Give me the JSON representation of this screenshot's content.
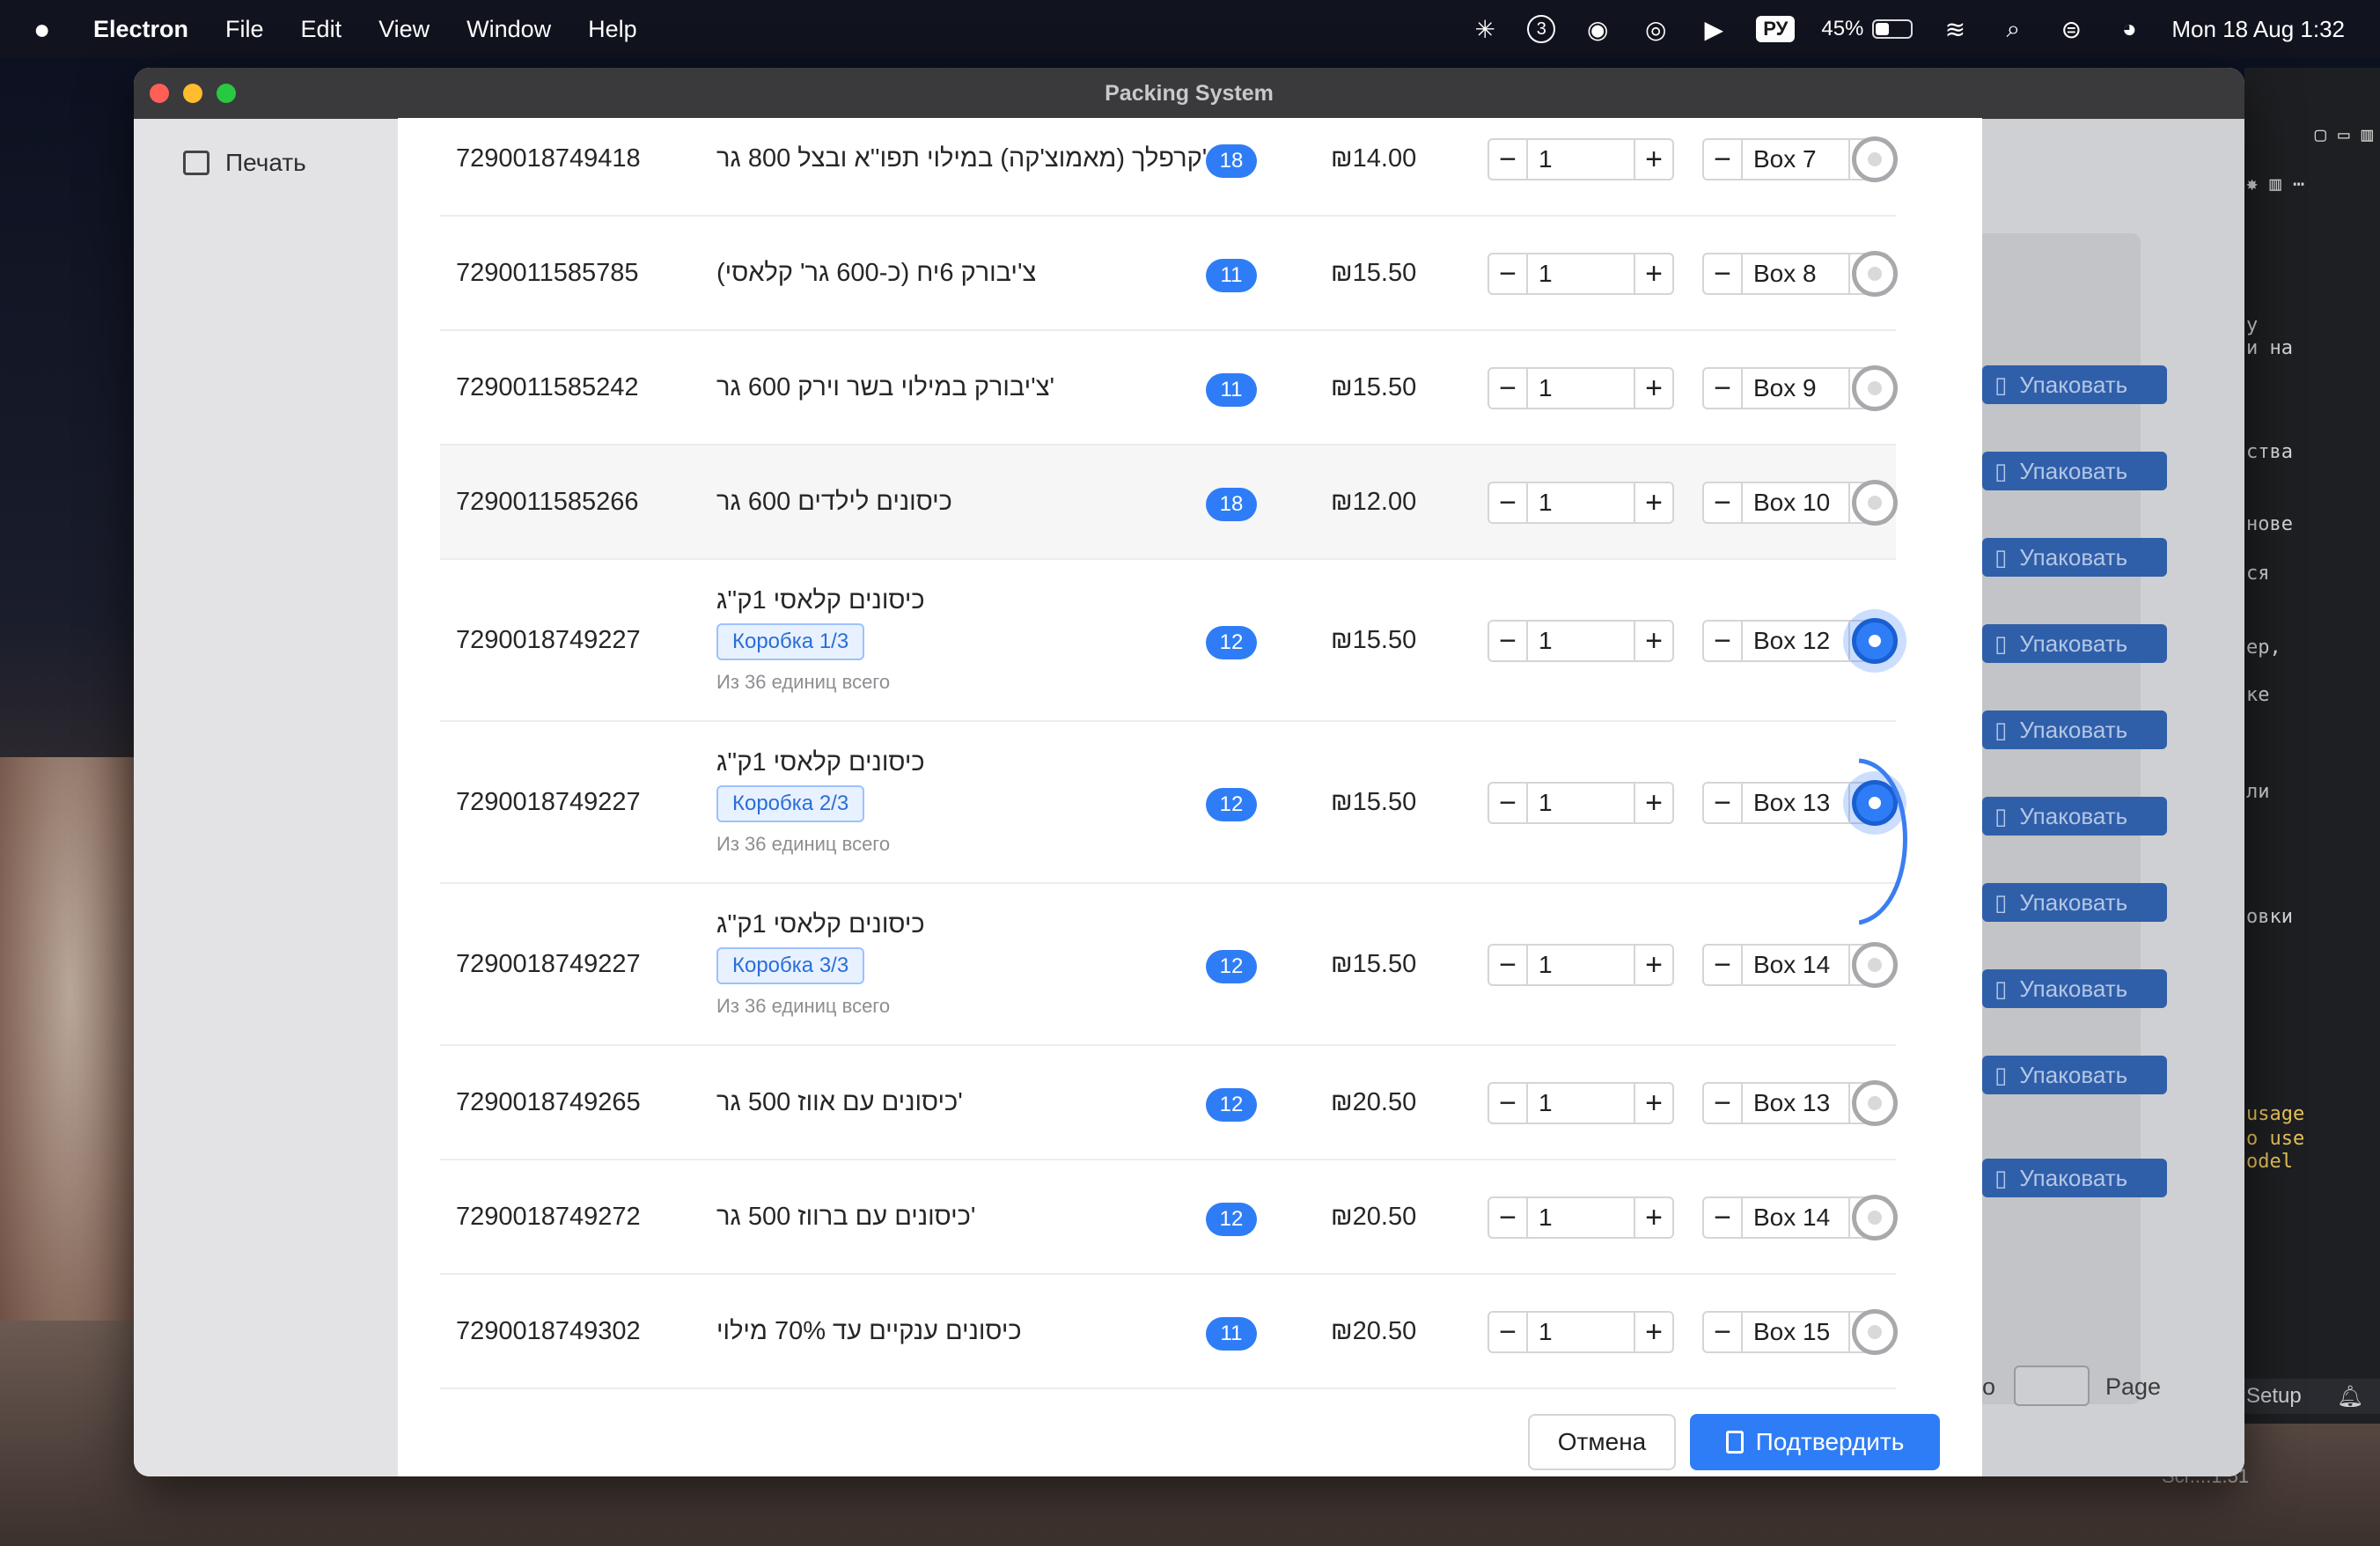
{
  "menubar": {
    "app": "Electron",
    "items": [
      "File",
      "Edit",
      "View",
      "Window",
      "Help"
    ],
    "lang": "РУ",
    "battery_pct": "45%",
    "battery_level": 0.45,
    "datetime": "Mon 18 Aug  1:32",
    "badge_count": "3"
  },
  "window": {
    "title": "Packing System",
    "print_label": "Печать",
    "pack_label": "Упаковать",
    "page_label": "Page",
    "page_prefix": "o"
  },
  "code_strip": {
    "lines": [
      "у",
      "и на",
      "ства",
      "нове",
      "ся",
      "ер,",
      "ке",
      "ли",
      "овки",
      "usage",
      "o use",
      "odel"
    ],
    "setup": "Setup",
    "dock_text": "Scr....1.51"
  },
  "modal": {
    "rows": [
      {
        "code": "7290018749418",
        "name": "קרפלך (מאמוצ'קה) במילוי תפו''א ובצל 800 גר'",
        "qty_badge": "18",
        "price": "₪14.00",
        "qty": "1",
        "box": "Box 7",
        "selected": false
      },
      {
        "code": "7290011585785",
        "name": "צ'יבורק 6יח (כ-600 גר' קלאסי)",
        "qty_badge": "11",
        "price": "₪15.50",
        "qty": "1",
        "box": "Box 8",
        "selected": false
      },
      {
        "code": "7290011585242",
        "name": "צ'יבורק במילוי בשר וירק 600 גר'",
        "qty_badge": "11",
        "price": "₪15.50",
        "qty": "1",
        "box": "Box 9",
        "selected": false
      },
      {
        "code": "7290011585266",
        "name": "כיסונים לילדים 600 גר",
        "qty_badge": "18",
        "price": "₪12.00",
        "qty": "1",
        "box": "Box 10",
        "selected": false,
        "highlight": true
      },
      {
        "code": "7290018749227",
        "name": "כיסונים קלאסי 1ק''ג",
        "chip": "Коробка 1/3",
        "note": "Из 36 единиц всего",
        "qty_badge": "12",
        "price": "₪15.50",
        "qty": "1",
        "box": "Box 12",
        "selected": true
      },
      {
        "code": "7290018749227",
        "name": "כיסונים קלאסי 1ק''ג",
        "chip": "Коробка 2/3",
        "note": "Из 36 единиц всего",
        "qty_badge": "12",
        "price": "₪15.50",
        "qty": "1",
        "box": "Box 13",
        "selected": true
      },
      {
        "code": "7290018749227",
        "name": "כיסונים קלאסי 1ק''ג",
        "chip": "Коробка 3/3",
        "note": "Из 36 единиц всего",
        "qty_badge": "12",
        "price": "₪15.50",
        "qty": "1",
        "box": "Box 14",
        "selected": false
      },
      {
        "code": "7290018749265",
        "name": "כיסונים עם אווז 500 גר'",
        "qty_badge": "12",
        "price": "₪20.50",
        "qty": "1",
        "box": "Box 13",
        "selected": false
      },
      {
        "code": "7290018749272",
        "name": "כיסונים עם ברווז 500 גר'",
        "qty_badge": "12",
        "price": "₪20.50",
        "qty": "1",
        "box": "Box 14",
        "selected": false
      },
      {
        "code": "7290018749302",
        "name": "כיסונים ענקיים עד 70% מילוי",
        "qty_badge": "11",
        "price": "₪20.50",
        "qty": "1",
        "box": "Box 15",
        "selected": false
      }
    ],
    "cancel_label": "Отмена",
    "confirm_label": "Подтвердить",
    "radio_glyph": "c",
    "minus": "−",
    "plus": "+"
  }
}
